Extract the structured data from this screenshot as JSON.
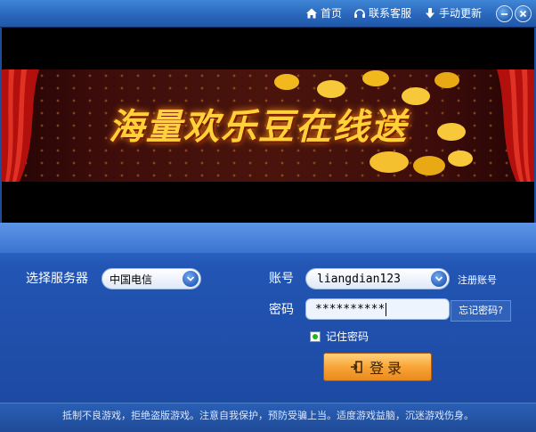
{
  "titlebar": {
    "home_label": "首页",
    "support_label": "联系客服",
    "update_label": "手动更新"
  },
  "banner": {
    "headline": "海量欢乐豆在线送"
  },
  "form": {
    "server_label": "选择服务器",
    "server_value": "中国电信",
    "account_label": "账号",
    "account_value": "liangdian123",
    "register_label": "注册账号",
    "password_label": "密码",
    "password_mask": "**********",
    "forgot_label": "忘记密码?",
    "remember_label": "记住密码",
    "remember_checked": true,
    "login_label": "登录"
  },
  "footer": {
    "notice": "抵制不良游戏，拒绝盗版游戏。注意自我保护，预防受骗上当。适度游戏益脑，沉迷游戏伤身。"
  },
  "colors": {
    "accent_blue": "#2a67bb",
    "login_orange": "#f8a437",
    "banner_gold": "#ffd23a"
  },
  "icons": [
    "home-icon",
    "headset-icon",
    "download-icon",
    "minimize-icon",
    "close-icon",
    "chevron-down-icon",
    "login-icon"
  ]
}
